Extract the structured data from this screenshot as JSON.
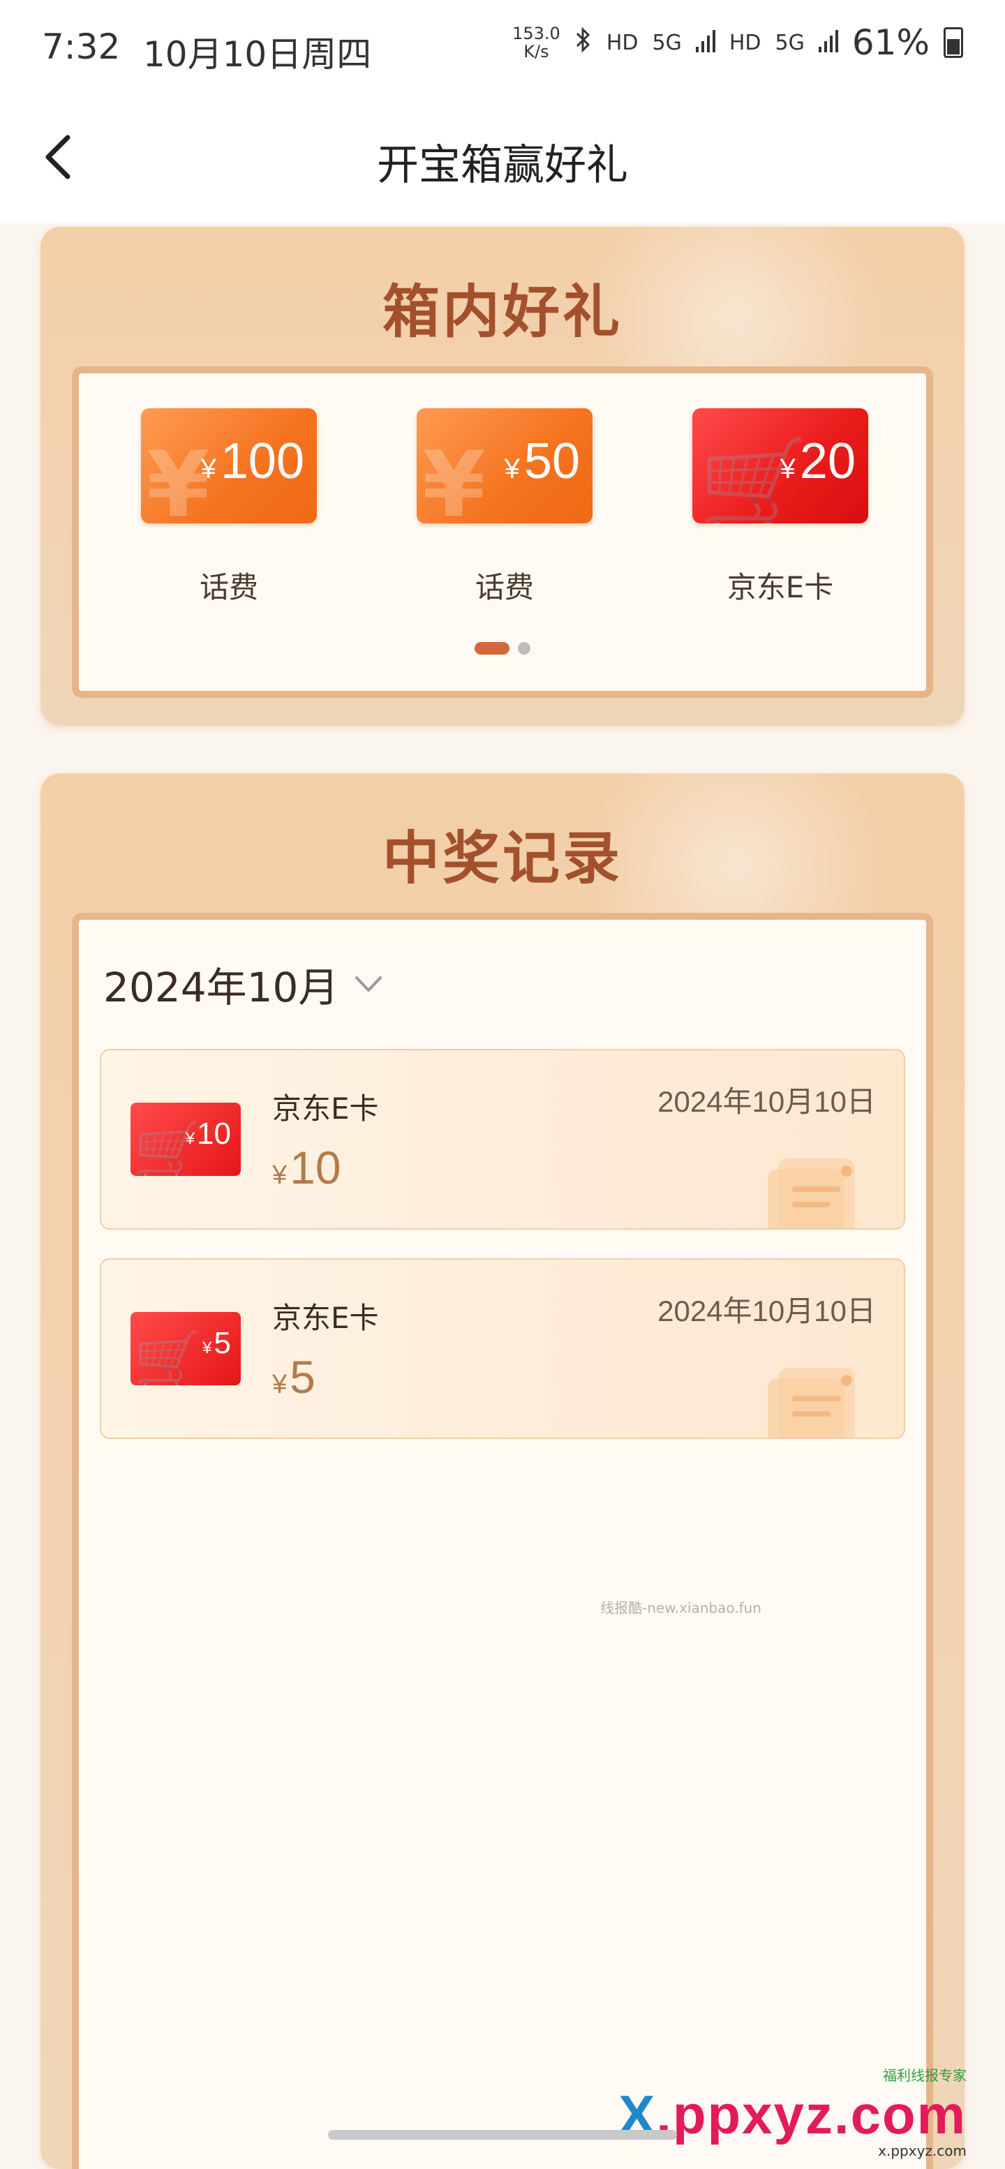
{
  "status_bar": {
    "time": "7:32",
    "date": "10月10日周四",
    "net_speed_value": "153.0",
    "net_speed_unit": "K/s",
    "bluetooth_icon": "bluetooth-icon",
    "hd1": "HD",
    "signal1": "5G",
    "hd2": "HD",
    "signal2": "5G",
    "battery": "61%"
  },
  "header": {
    "title": "开宝箱赢好礼",
    "back_icon": "back-arrow-icon"
  },
  "gifts": {
    "title": "箱内好礼",
    "items": [
      {
        "amount": "100",
        "currency": "¥",
        "label": "话费",
        "color": "#f4731f"
      },
      {
        "amount": "50",
        "currency": "¥",
        "label": "话费",
        "color": "#f4731f"
      },
      {
        "amount": "20",
        "currency": "¥",
        "label": "京东E卡",
        "color": "#e61616"
      }
    ],
    "page_count": 2,
    "active_page": 1
  },
  "records": {
    "title": "中奖记录",
    "month": "2024年10月",
    "items": [
      {
        "name": "京东E卡",
        "thumb_amount": "10",
        "currency": "¥",
        "value": "10",
        "date": "2024年10月10日"
      },
      {
        "name": "京东E卡",
        "thumb_amount": "5",
        "currency": "¥",
        "value": "5",
        "date": "2024年10月10日"
      }
    ]
  },
  "watermark": {
    "text": "线报酷-new.xianbao.fun",
    "brand_tag": "福利线报专家",
    "brand_x": "X",
    "brand_rest": ".ppxyz.com",
    "brand_sub": "x.ppxyz.com"
  },
  "colors": {
    "accent_title": "#a2512c",
    "panel_bg": "#f3cfa8",
    "orange_card": "#f4731f",
    "red_card": "#e61616"
  }
}
